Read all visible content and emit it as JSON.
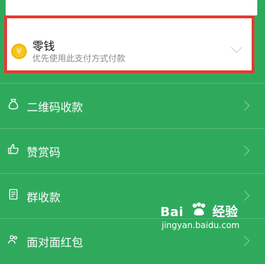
{
  "payment_method": {
    "title": "零钱",
    "subtitle": "优先使用此支付方式付款",
    "icon": "coin-icon",
    "chevron_icon": "chevron-down-icon"
  },
  "menu": [
    {
      "label": "二维码收款",
      "icon": "money-bag-icon"
    },
    {
      "label": "赞赏码",
      "icon": "thumbs-up-icon"
    },
    {
      "label": "群收款",
      "icon": "document-icon"
    },
    {
      "label": "面对面红包",
      "icon": "people-icon"
    }
  ],
  "watermark": {
    "brand": "Bai",
    "brand_suffix": "经验",
    "url": "jingyan.baidu.com"
  },
  "colors": {
    "background": "#2faa5d",
    "highlight_border": "#e53935",
    "card": "#ffffff"
  }
}
